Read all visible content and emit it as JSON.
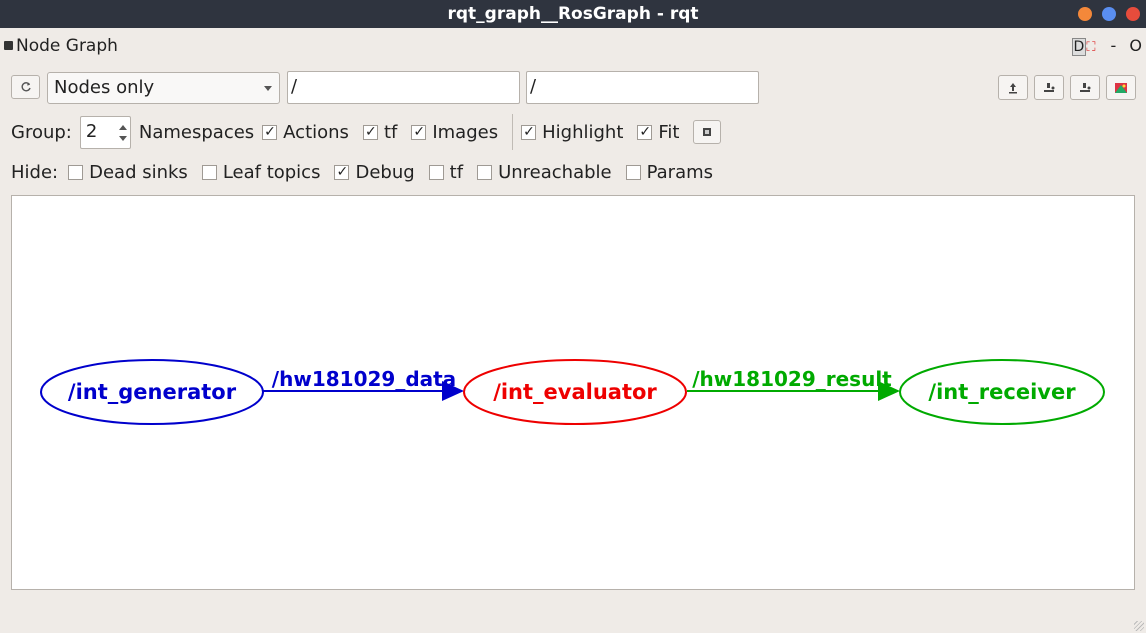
{
  "window": {
    "title": "rqt_graph__RosGraph - rqt"
  },
  "dock": {
    "title": "Node Graph",
    "ctrl_d": "D",
    "ctrl_minus": "-",
    "ctrl_o": "O"
  },
  "toolbar": {
    "refresh_icon": "refresh-icon",
    "mode_selected": "Nodes only",
    "node_filter_value": "/",
    "topic_filter_value": "/",
    "right_icons": [
      "load-icon",
      "save-dot-icon",
      "save-svg-icon",
      "screenshot-icon"
    ]
  },
  "group_row": {
    "group_label": "Group:",
    "group_value": "2",
    "namespaces_label": "Namespaces",
    "actions": {
      "label": "Actions",
      "checked": true
    },
    "tf": {
      "label": "tf",
      "checked": true
    },
    "images": {
      "label": "Images",
      "checked": true
    },
    "highlight": {
      "label": "Highlight",
      "checked": true
    },
    "fit": {
      "label": "Fit",
      "checked": true
    }
  },
  "hide_row": {
    "label": "Hide:",
    "items": [
      {
        "label": "Dead sinks",
        "checked": false
      },
      {
        "label": "Leaf topics",
        "checked": false
      },
      {
        "label": "Debug",
        "checked": true
      },
      {
        "label": "tf",
        "checked": false
      },
      {
        "label": "Unreachable",
        "checked": false
      },
      {
        "label": "Params",
        "checked": false
      }
    ]
  },
  "graph": {
    "nodes": [
      {
        "label": "/int_generator",
        "color": "#0000cc"
      },
      {
        "label": "/int_evaluator",
        "color": "#ee0000"
      },
      {
        "label": "/int_receiver",
        "color": "#00aa00"
      }
    ],
    "edges": [
      {
        "label": "/hw181029_data",
        "color": "#0000cc"
      },
      {
        "label": "/hw181029_result",
        "color": "#00aa00"
      }
    ]
  },
  "colors": {
    "titlebar": "#2f343f",
    "close": "#e74c3c",
    "min": "#f4883a",
    "max": "#5a8ef0"
  }
}
